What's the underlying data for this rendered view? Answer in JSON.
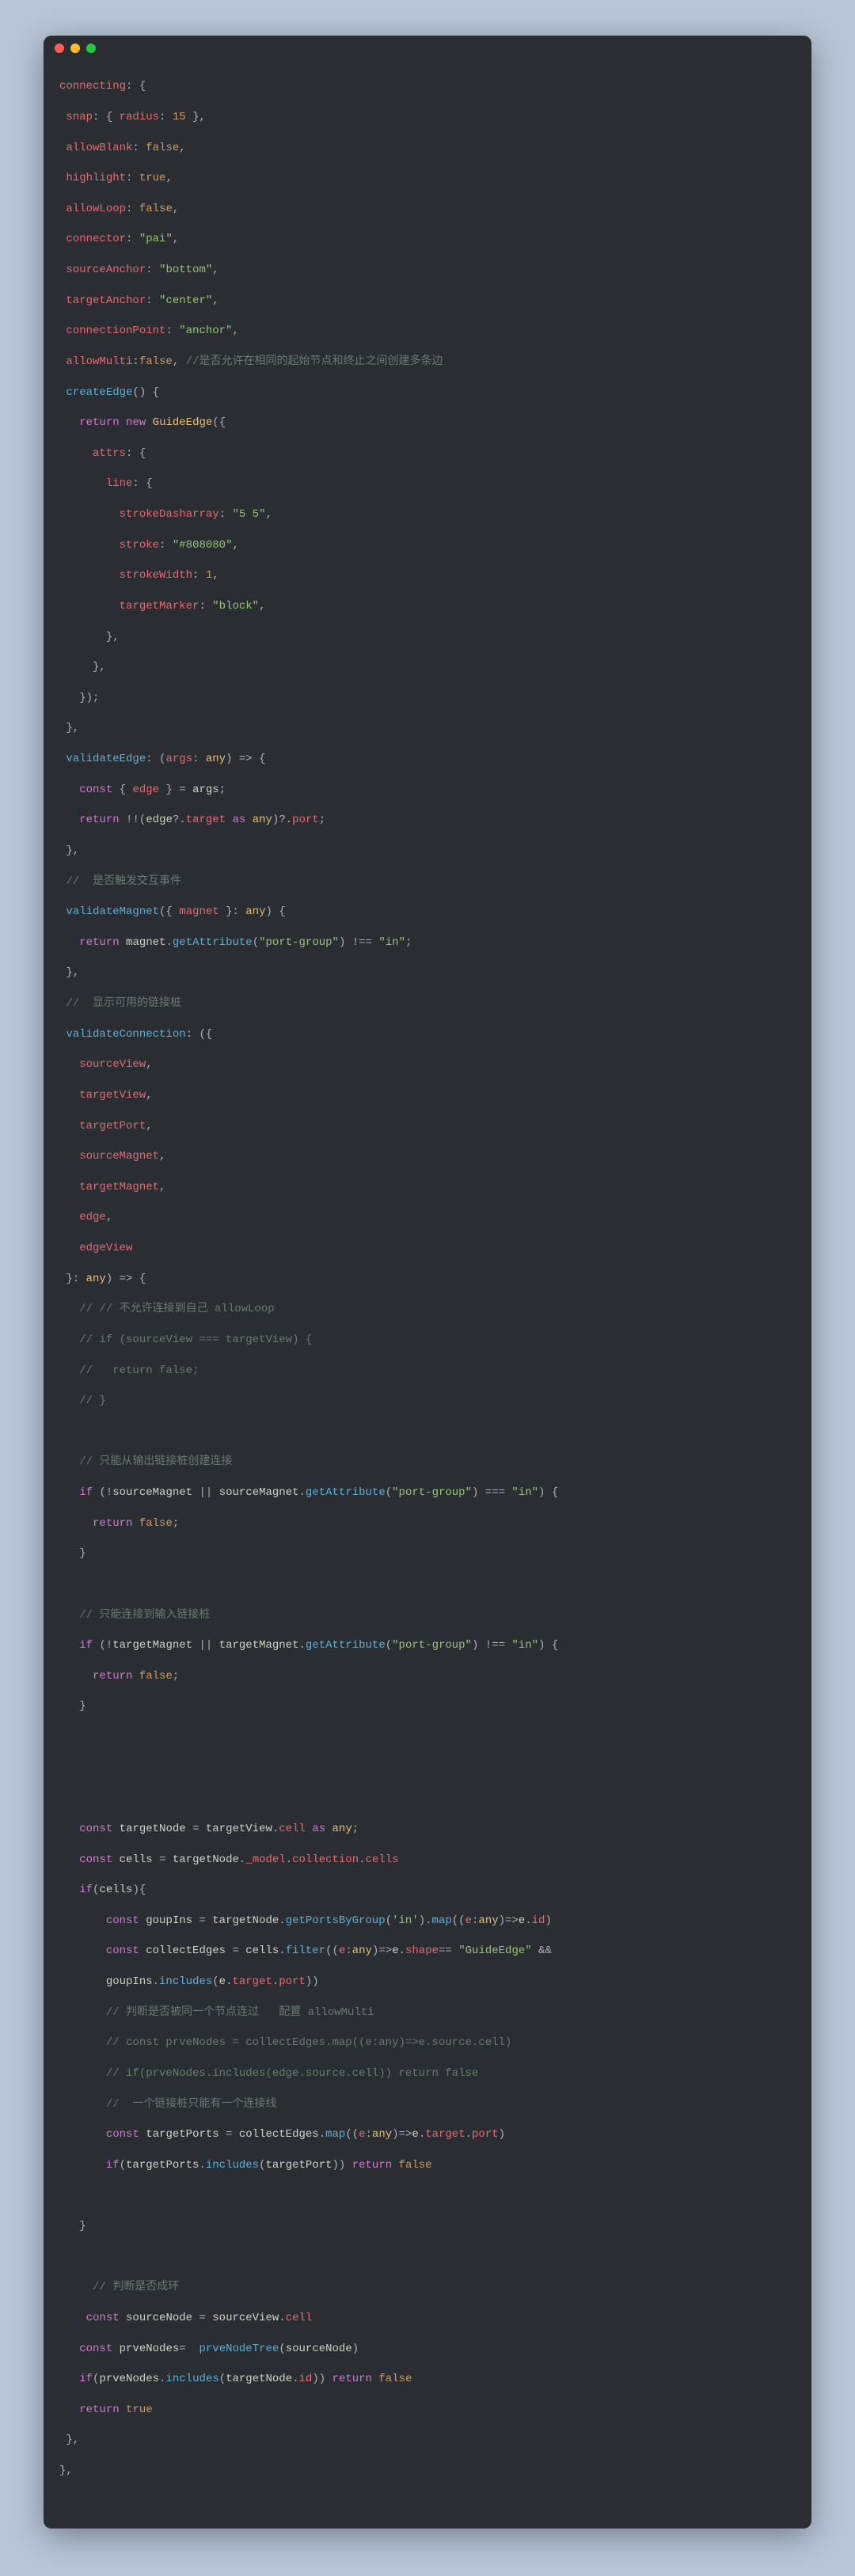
{
  "code": {
    "kw": {
      "return": "return",
      "new": "new",
      "const": "const",
      "if": "if",
      "as": "as",
      "false": "false",
      "true": "true"
    },
    "cls": {
      "GuideEdge": "GuideEdge"
    },
    "tp": {
      "any": "any"
    },
    "num": {
      "n15": "15",
      "n1": "1"
    },
    "str": {
      "pai": "\"pai\"",
      "bottom": "\"bottom\"",
      "center": "\"center\"",
      "anchor": "\"anchor\"",
      "5_5": "\"5 5\"",
      "color": "\"#808080\"",
      "block": "\"block\"",
      "port_group": "\"port-group\"",
      "in": "\"in\"",
      "in_single": "'in'",
      "guide_edge": "\"GuideEdge\""
    },
    "fnn": {
      "createEdge": "createEdge",
      "validateEdge": "validateEdge",
      "validateMagnet": "validateMagnet",
      "validateConnection": "validateConnection",
      "getAttribute": "getAttribute",
      "getPortsByGroup": "getPortsByGroup",
      "map": "map",
      "filter": "filter",
      "includes": "includes",
      "prveNodeTree": "prveNodeTree"
    },
    "id": {
      "connecting": "connecting",
      "snap": "snap",
      "radius": "radius",
      "allowBlank": "allowBlank",
      "highlight": "highlight",
      "allowLoop": "allowLoop",
      "connector": "connector",
      "sourceAnchor": "sourceAnchor",
      "targetAnchor": "targetAnchor",
      "connectionPoint": "connectionPoint",
      "allowMulti": "allowMulti",
      "attrs": "attrs",
      "line": "line",
      "strokeDasharray": "strokeDasharray",
      "stroke": "stroke",
      "strokeWidth": "strokeWidth",
      "targetMarker": "targetMarker",
      "args": "args",
      "edge": "edge",
      "target": "target",
      "port": "port",
      "magnet": "magnet",
      "sourceView": "sourceView",
      "targetView": "targetView",
      "targetPort": "targetPort",
      "sourceMagnet": "sourceMagnet",
      "targetMagnet": "targetMagnet",
      "edgeView": "edgeView",
      "cell": "cell",
      "targetNode": "targetNode",
      "cells": "cells",
      "_model": "_model",
      "collection": "collection",
      "goupIns": "goupIns",
      "e": "e",
      "id": "id",
      "collectEdges": "collectEdges",
      "shape": "shape",
      "source": "source",
      "targetPorts": "targetPorts",
      "sourceNode": "sourceNode",
      "prveNodes": "prveNodes"
    },
    "cmt": {
      "allowMultiComment": "//是否允许在相同的起始节点和终止之间创建多条边",
      "trigger": "//  是否触发交互事件",
      "showPorts": "//  显示可用的链接桩",
      "noSelf": "// // 不允许连接到自己 allowLoop",
      "ifSame": "// if (sourceView === targetView) {",
      "retFalse": "//   return false;",
      "close": "// }",
      "outOnly": "// 只能从输出链接桩创建连接",
      "inOnly": "// 只能连接到输入链接桩",
      "sameNode": "// 判断是否被同一个节点连过   配置 allowMulti",
      "prveNodesMap": "// const prveNodes = collectEdges.map((e:any)=>e.source.cell)",
      "prveIncludes": "// if(prveNodes.includes(edge.source.cell)) return false",
      "onePort": "//  一个链接桩只能有一个连接线",
      "isLoop": "// 判断是否成环"
    }
  }
}
